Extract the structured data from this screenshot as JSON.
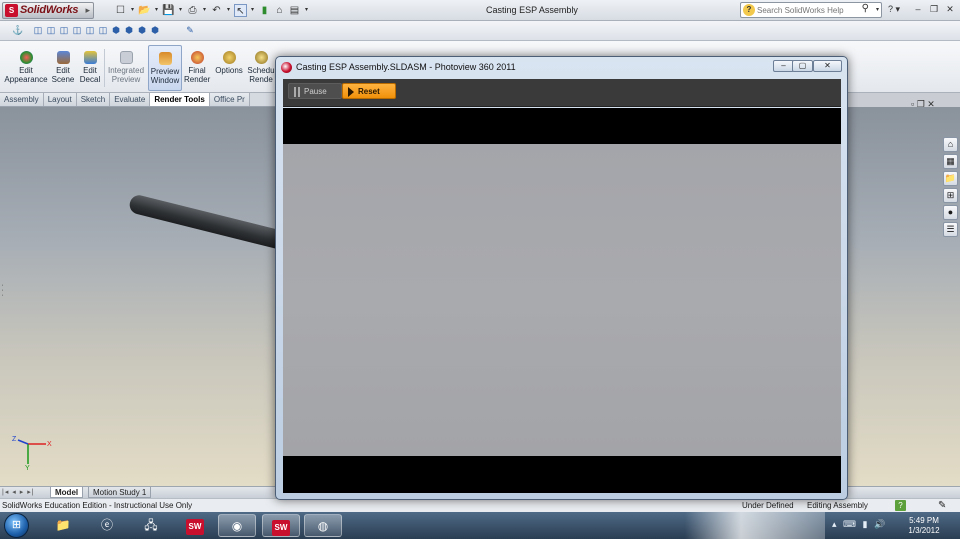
{
  "app": {
    "logo_text": "SolidWorks",
    "window_title": "Casting ESP Assembly",
    "help_search_placeholder": "Search SolidWorks Help"
  },
  "ribbon": {
    "buttons": [
      {
        "l1": "Edit",
        "l2": "Appearance"
      },
      {
        "l1": "Edit",
        "l2": "Scene"
      },
      {
        "l1": "Edit",
        "l2": "Decal"
      },
      {
        "l1": "Integrated",
        "l2": "Preview"
      },
      {
        "l1": "Preview",
        "l2": "Window"
      },
      {
        "l1": "Final",
        "l2": "Render"
      },
      {
        "l1": "Options",
        "l2": ""
      },
      {
        "l1": "Schedu",
        "l2": "Rende"
      }
    ]
  },
  "cm_tabs": [
    "Assembly",
    "Layout",
    "Sketch",
    "Evaluate",
    "Render Tools",
    "Office Pr"
  ],
  "bottom_tabs": {
    "model": "Model",
    "motion": "Motion Study 1"
  },
  "status": {
    "edition": "SolidWorks Education Edition - Instructional Use Only",
    "defined": "Under Defined",
    "mode": "Editing Assembly"
  },
  "photoview": {
    "title": "Casting ESP Assembly.SLDASM - Photoview 360 2011",
    "pause_label": "Pause",
    "reset_label": "Reset"
  },
  "triad": {
    "x": "X",
    "y": "Y",
    "z": "Z"
  },
  "taskbar": {
    "time": "5:49 PM",
    "date": "1/3/2012"
  },
  "colors": {
    "accent_orange": "#f5a020",
    "sw_red": "#c8102e"
  }
}
